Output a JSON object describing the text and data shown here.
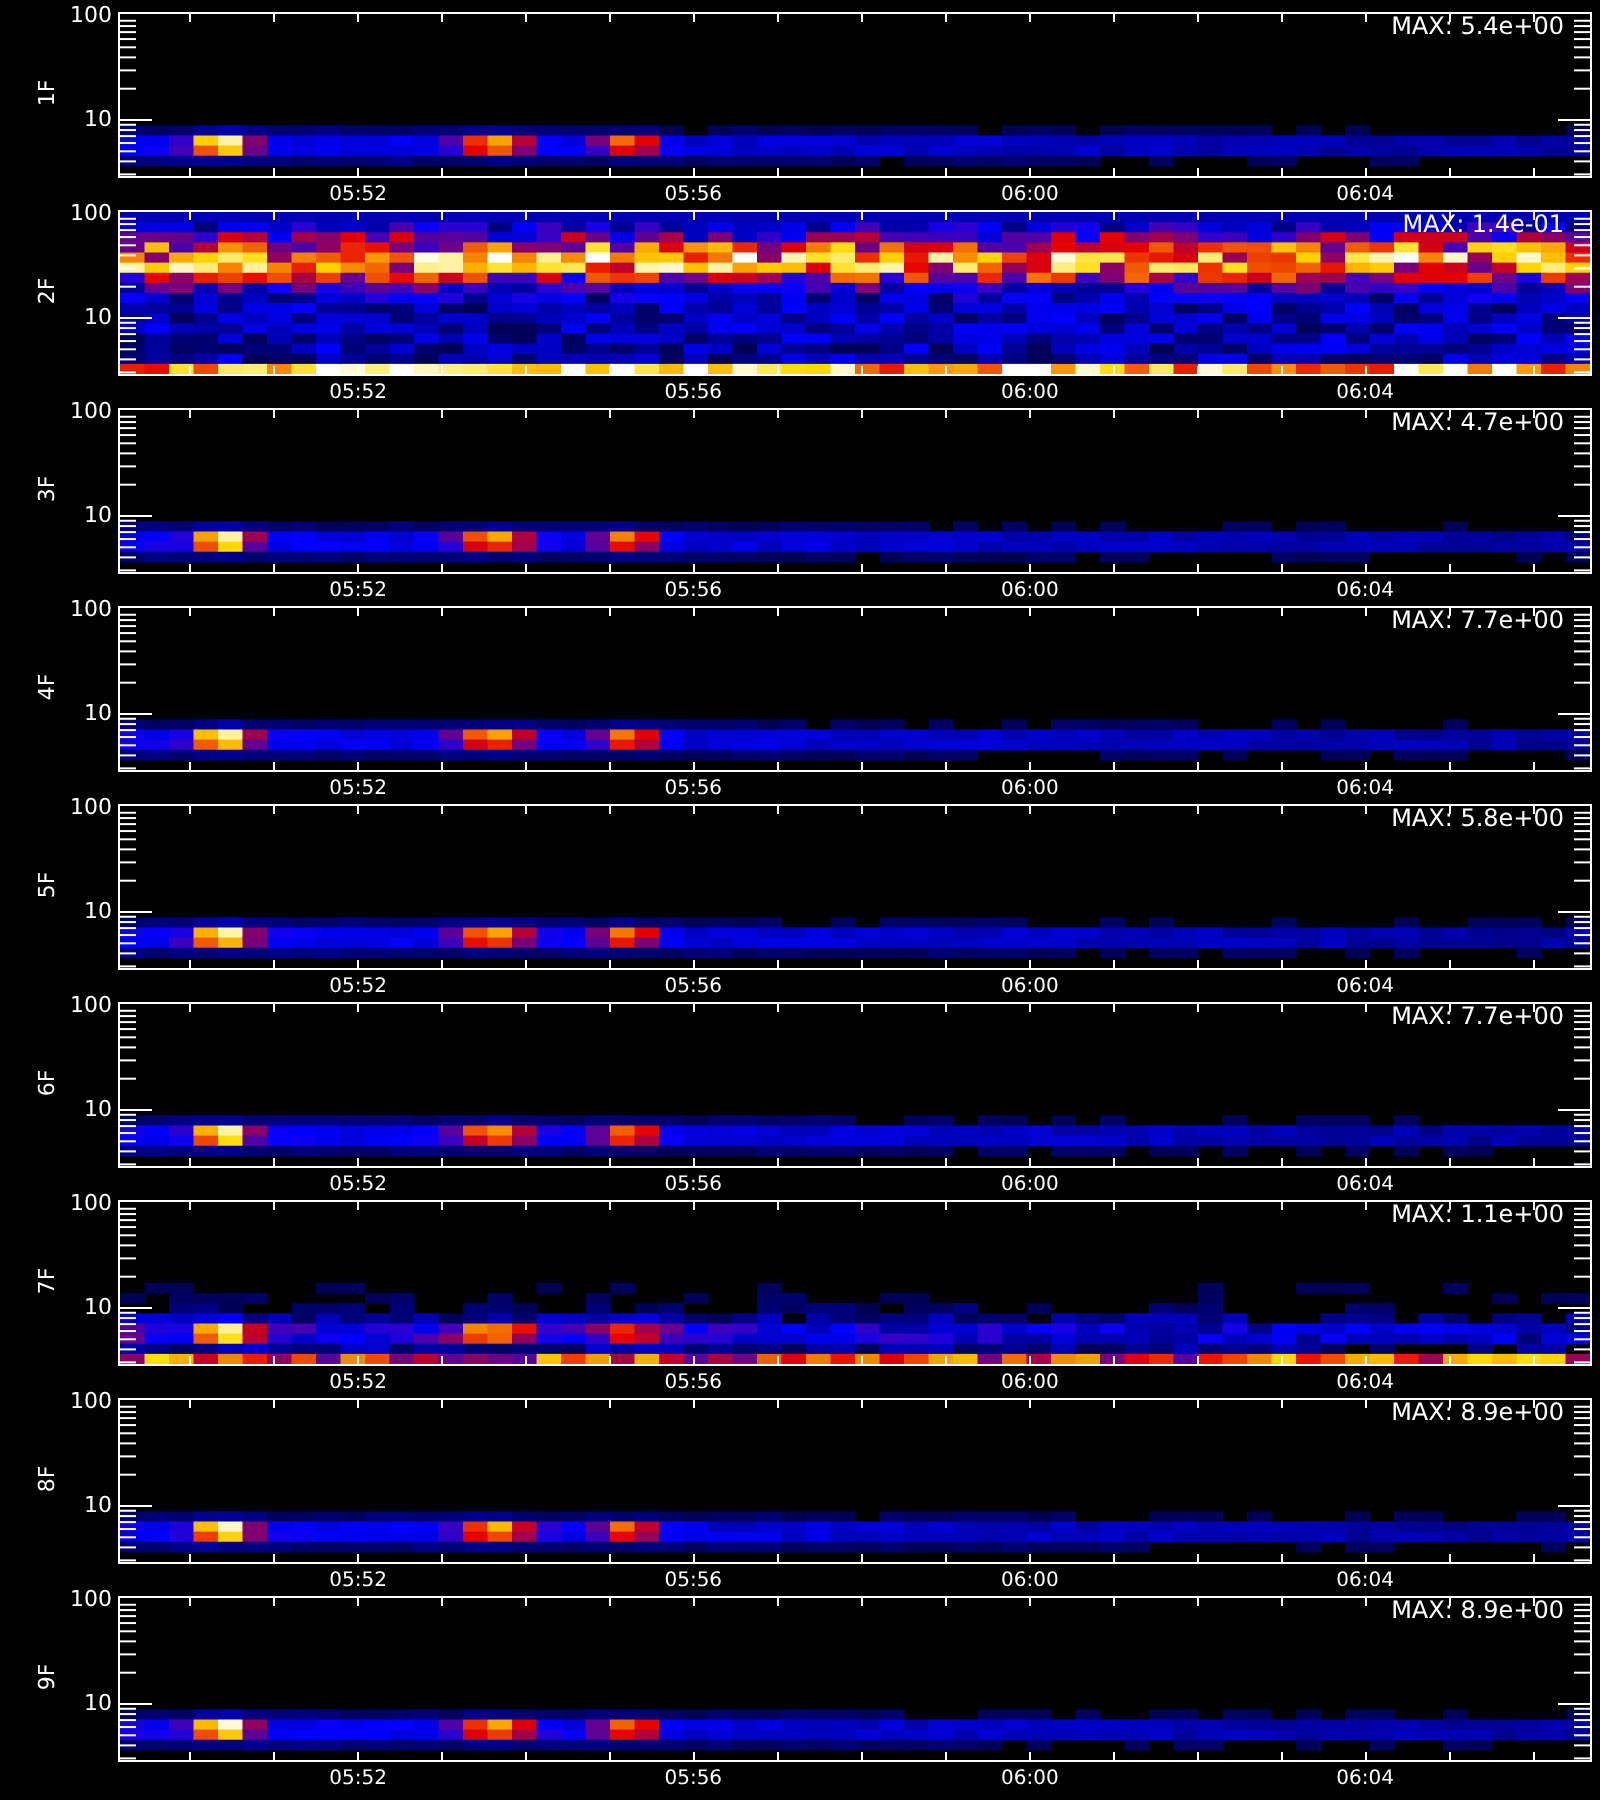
{
  "panels": [
    {
      "label": "1F",
      "max": "MAX: 5.4e+00",
      "kind": "quiet",
      "yticks": [
        "100",
        "10"
      ],
      "xticks": [
        "05:52",
        "05:56",
        "06:00",
        "06:04"
      ]
    },
    {
      "label": "2F",
      "max": "MAX: 1.4e-01",
      "kind": "noisy",
      "yticks": [
        "100",
        "10"
      ],
      "xticks": [
        "05:52",
        "05:56",
        "06:00",
        "06:04"
      ]
    },
    {
      "label": "3F",
      "max": "MAX: 4.7e+00",
      "kind": "quiet",
      "yticks": [
        "100",
        "10"
      ],
      "xticks": [
        "05:52",
        "05:56",
        "06:00",
        "06:04"
      ]
    },
    {
      "label": "4F",
      "max": "MAX: 7.7e+00",
      "kind": "quiet",
      "yticks": [
        "100",
        "10"
      ],
      "xticks": [
        "05:52",
        "05:56",
        "06:00",
        "06:04"
      ]
    },
    {
      "label": "5F",
      "max": "MAX: 5.8e+00",
      "kind": "quiet",
      "yticks": [
        "100",
        "10"
      ],
      "xticks": [
        "05:52",
        "05:56",
        "06:00",
        "06:04"
      ]
    },
    {
      "label": "6F",
      "max": "MAX: 7.7e+00",
      "kind": "quiet",
      "yticks": [
        "100",
        "10"
      ],
      "xticks": [
        "05:52",
        "05:56",
        "06:00",
        "06:04"
      ]
    },
    {
      "label": "7F",
      "max": "MAX: 1.1e+00",
      "kind": "banded",
      "yticks": [
        "100",
        "10"
      ],
      "xticks": [
        "05:52",
        "05:56",
        "06:00",
        "06:04"
      ]
    },
    {
      "label": "8F",
      "max": "MAX: 8.9e+00",
      "kind": "quiet",
      "yticks": [
        "100",
        "10"
      ],
      "xticks": [
        "05:52",
        "05:56",
        "06:00",
        "06:04"
      ]
    },
    {
      "label": "9F",
      "max": "MAX: 8.9e+00",
      "kind": "quiet",
      "yticks": [
        "100",
        "10"
      ],
      "xticks": [
        "05:52",
        "05:56",
        "06:00",
        "06:04"
      ]
    }
  ]
}
